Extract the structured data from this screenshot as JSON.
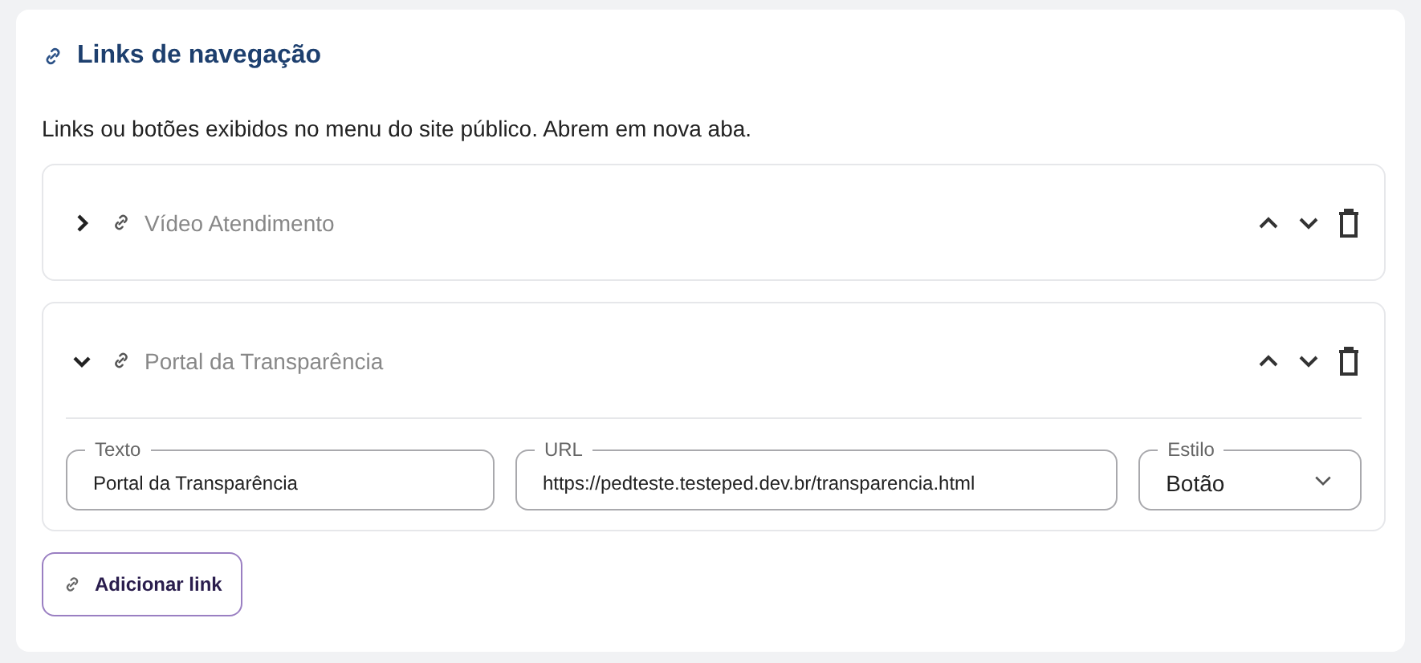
{
  "section": {
    "title": "Links de navegação",
    "description": "Links ou botões exibidos no menu do site público. Abrem em nova aba."
  },
  "links": [
    {
      "title": "Vídeo Atendimento",
      "expanded": false
    },
    {
      "title": "Portal da Transparência",
      "expanded": true,
      "fields": [
        {
          "kind": "text",
          "label": "Texto",
          "value": "Portal da Transparência"
        },
        {
          "kind": "text",
          "label": "URL",
          "value": "https://pedteste.testeped.dev.br/transparencia.html"
        },
        {
          "kind": "select",
          "label": "Estilo",
          "value": "Botão"
        }
      ]
    }
  ],
  "add_button": "Adicionar link"
}
